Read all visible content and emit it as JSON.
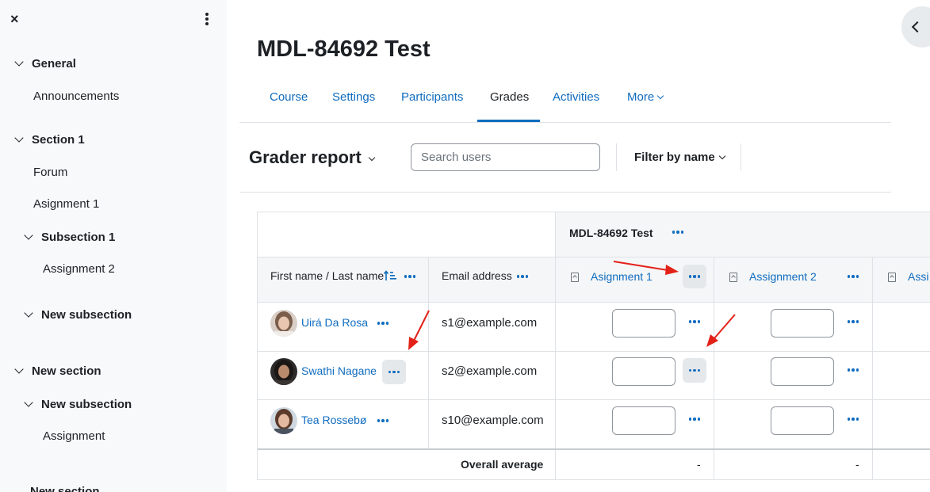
{
  "sidebar": {
    "close_icon": "×",
    "items": [
      {
        "label": "General"
      },
      {
        "label": "Announcements"
      },
      {
        "label": "Section 1"
      },
      {
        "label": "Forum"
      },
      {
        "label": "Asignment 1"
      },
      {
        "label": "Subsection 1"
      },
      {
        "label": "Assignment 2"
      },
      {
        "label": "New subsection"
      },
      {
        "label": "New section"
      },
      {
        "label": "New subsection"
      },
      {
        "label": "Assignment"
      },
      {
        "label": "New section"
      }
    ]
  },
  "page": {
    "title": "MDL-84692 Test"
  },
  "tabs": [
    {
      "label": "Course"
    },
    {
      "label": "Settings"
    },
    {
      "label": "Participants"
    },
    {
      "label": "Grades"
    },
    {
      "label": "Activities"
    },
    {
      "label": "More"
    }
  ],
  "toolbar": {
    "report_title": "Grader report",
    "search_placeholder": "Search users",
    "filter_label": "Filter by name"
  },
  "table": {
    "category_header": "MDL-84692 Test",
    "col_name": "First name / Last name",
    "col_email": "Email address",
    "assignments": [
      "Asignment 1",
      "Assignment 2",
      "Assi"
    ],
    "rows": [
      {
        "name": "Uirá Da Rosa",
        "email": "s1@example.com",
        "grade1": "",
        "grade2": ""
      },
      {
        "name": "Swathi Nagane",
        "email": "s2@example.com",
        "grade1": "",
        "grade2": ""
      },
      {
        "name": "Tea Rossebø",
        "email": "s10@example.com",
        "grade1": "",
        "grade2": ""
      }
    ],
    "overall_label": "Overall average",
    "overall_values": [
      "-",
      "-"
    ]
  },
  "colors": {
    "link": "#0f6cbf",
    "arrow": "#e32119",
    "sidebar_bg": "#f8f9fa"
  }
}
